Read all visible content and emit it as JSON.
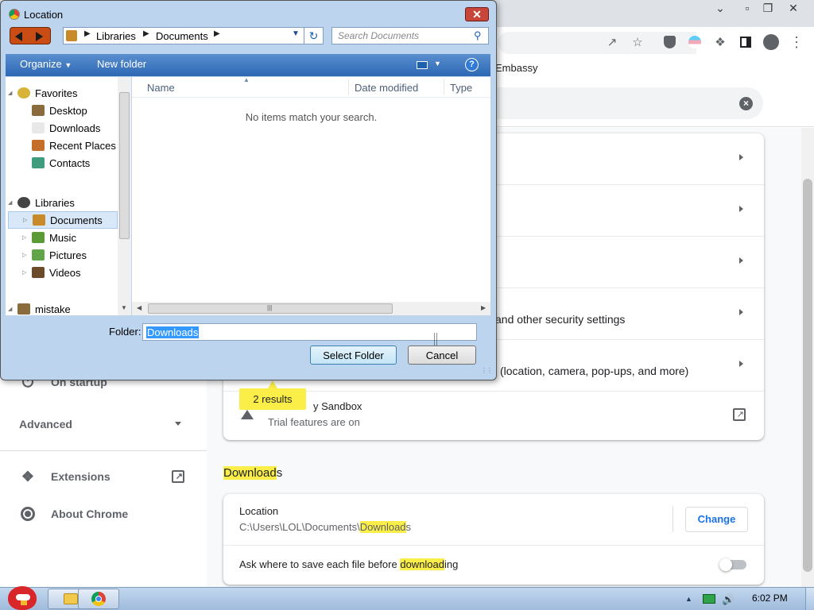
{
  "browser": {
    "bookmark_label": "Embassy"
  },
  "sidebar": {
    "on_startup": "On startup",
    "advanced": "Advanced",
    "extensions": "Extensions",
    "about_chrome": "About Chrome"
  },
  "privacy": {
    "security_row": "and other security settings",
    "site_settings_row": "(location, camera, pop-ups, and more)",
    "sandbox_title": "y Sandbox",
    "sandbox_subtitle": "Trial features are on",
    "results_badge": "2 results"
  },
  "downloads": {
    "section_title_hl": "Download",
    "section_title_rest": "s",
    "location_label": "Location",
    "location_path_pre": "C:\\Users\\LOL\\Documents\\",
    "location_path_hl": "Download",
    "location_path_post": "s",
    "change_button": "Change",
    "ask_pre": "Ask where to save each file before ",
    "ask_hl": "download",
    "ask_post": "ing"
  },
  "dialog": {
    "title": "Location",
    "breadcrumb": [
      "Libraries",
      "Documents"
    ],
    "search_placeholder": "Search Documents",
    "organize": "Organize",
    "new_folder": "New folder",
    "nav_tree": [
      {
        "label": "Favorites",
        "level": 0,
        "icon": "star-icon",
        "color": "#d7b338"
      },
      {
        "label": "Desktop",
        "level": 1,
        "icon": "desktop-icon",
        "color": "#8a6b3e"
      },
      {
        "label": "Downloads",
        "level": 1,
        "icon": "downloads-folder-icon",
        "color": "#e8e8e8"
      },
      {
        "label": "Recent Places",
        "level": 1,
        "icon": "recent-places-icon",
        "color": "#c46e2c"
      },
      {
        "label": "Contacts",
        "level": 1,
        "icon": "contacts-icon",
        "color": "#3f9c7c"
      }
    ],
    "libraries_tree": [
      {
        "label": "Libraries",
        "level": 0,
        "icon": "libraries-icon",
        "color": "#444444"
      },
      {
        "label": "Documents",
        "level": 1,
        "icon": "documents-library-icon",
        "color": "#c98a2a",
        "selected": true
      },
      {
        "label": "Music",
        "level": 1,
        "icon": "music-library-icon",
        "color": "#5b9b35"
      },
      {
        "label": "Pictures",
        "level": 1,
        "icon": "pictures-library-icon",
        "color": "#62a44a"
      },
      {
        "label": "Videos",
        "level": 1,
        "icon": "videos-library-icon",
        "color": "#6b4b2a"
      },
      {
        "label": "mistake",
        "level": 0,
        "icon": "user-folder-icon",
        "color": "#8a6b3e"
      }
    ],
    "columns": [
      "Name",
      "Date modified",
      "Type"
    ],
    "empty_message": "No items match your search.",
    "folder_label": "Folder:",
    "folder_value": "Downloads",
    "select_folder": "Select Folder",
    "cancel": "Cancel"
  },
  "taskbar": {
    "time": "6:02 PM"
  }
}
